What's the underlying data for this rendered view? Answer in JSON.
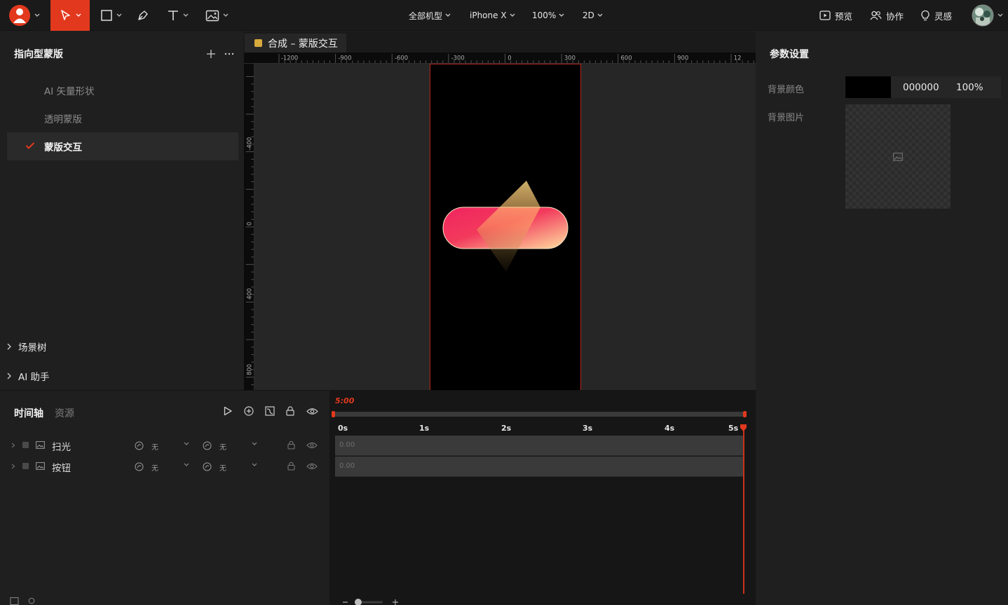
{
  "toolbar": {
    "menus": {
      "device_family": "全部机型",
      "device": "iPhone X",
      "zoom": "100%",
      "mode": "2D"
    },
    "preview_label": "预览",
    "collab_label": "协作",
    "inspire_label": "灵感"
  },
  "left_panel": {
    "title": "指向型蒙版",
    "items": [
      {
        "label": "AI 矢量形状",
        "active": false
      },
      {
        "label": "透明蒙版",
        "active": false
      },
      {
        "label": "蒙版交互",
        "active": true
      }
    ],
    "scene_tree_label": "场景树",
    "ai_helper_label": "AI 助手"
  },
  "canvas": {
    "tab_title": "合成 – 蒙版交互",
    "ruler_h_ticks": [
      "-1200",
      "-900",
      "-600",
      "-300",
      "0",
      "300",
      "600",
      "900",
      "12"
    ],
    "ruler_v_ticks": [
      "-400",
      "0",
      "400",
      "800"
    ]
  },
  "properties": {
    "title": "参数设置",
    "bg_color_label": "背景颜色",
    "bg_color_hex": "000000",
    "bg_color_opacity": "100%",
    "bg_image_label": "背景图片"
  },
  "timeline": {
    "tab_timeline": "时间轴",
    "tab_assets": "资源",
    "current_time": "5:00",
    "ticks": [
      "0s",
      "1s",
      "2s",
      "3s",
      "4s",
      "5s"
    ],
    "layers": [
      {
        "name": "扫光",
        "ease_in": "无",
        "ease_out": "无",
        "value": "0.00"
      },
      {
        "name": "按钮",
        "ease_in": "无",
        "ease_out": "无",
        "value": "0.00"
      }
    ]
  },
  "colors": {
    "accent": "#e2391e",
    "panel": "#1f1f1f",
    "canvas_bg": "#262626",
    "artboard_border": "#b3261e",
    "pill_start": "#f0245f",
    "pill_end": "#ffe0a0"
  }
}
